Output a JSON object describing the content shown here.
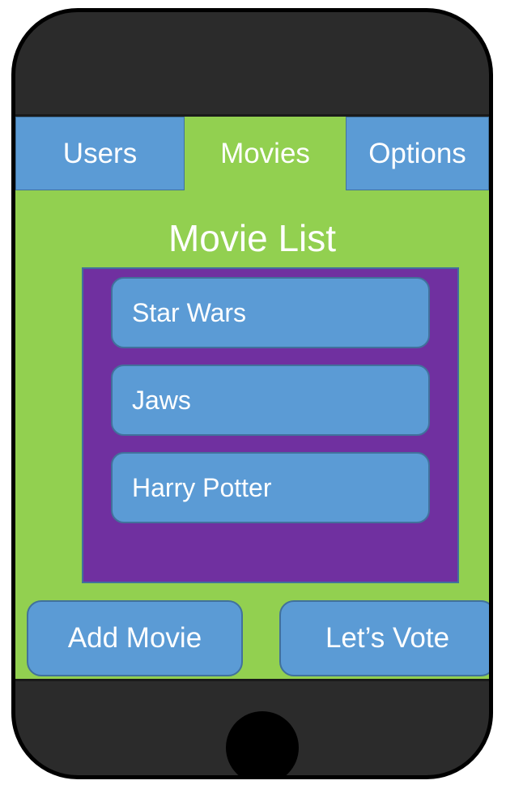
{
  "tabs": [
    {
      "label": "Users",
      "active": false
    },
    {
      "label": "Movies",
      "active": true
    },
    {
      "label": "Options",
      "active": false
    }
  ],
  "page": {
    "title": "Movie List"
  },
  "movies": [
    {
      "title": "Star Wars"
    },
    {
      "title": "Jaws"
    },
    {
      "title": "Harry Potter"
    }
  ],
  "actions": {
    "add_label": "Add Movie",
    "vote_label": "Let’s Vote"
  },
  "colors": {
    "phone_body": "#2b2b2b",
    "screen_bg": "#92d050",
    "tab_bg": "#5b9bd5",
    "list_bg": "#7030a0",
    "item_bg": "#5b9bd5",
    "text": "#ffffff"
  }
}
